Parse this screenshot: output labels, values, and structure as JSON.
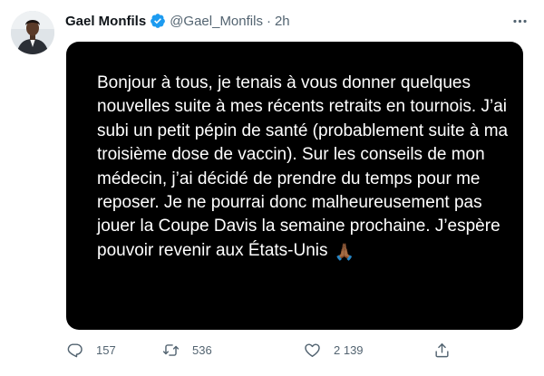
{
  "author": {
    "name": "Gael Monfils",
    "handle": "@Gael_Monfils",
    "separator": "·",
    "time": "2h",
    "verified_color": "#1d9bf0"
  },
  "media": {
    "text": "Bonjour à tous, je tenais à vous donner quelques nouvelles suite à mes récents retraits en tournois. J’ai subi un petit pépin de santé (probablement suite à ma troisième dose de vaccin). Sur les conseils de mon médecin, j’ai décidé de prendre du temps pour me reposer. Je ne pourrai donc malheureusement pas jouer la Coupe Davis la semaine prochaine. J’espère pouvoir revenir aux États-Unis",
    "emoji": "🙏🏾"
  },
  "actions": {
    "replies": "157",
    "retweets": "536",
    "likes": "2 139"
  },
  "icons": {
    "avatar": "avatar-photo",
    "verified": "verified-badge-icon",
    "more": "more-icon",
    "reply": "reply-icon",
    "retweet": "retweet-icon",
    "like": "heart-icon",
    "share": "share-icon"
  },
  "colors": {
    "text_primary": "#0f1419",
    "text_secondary": "#536471",
    "media_background": "#000000",
    "media_text": "#ffffff"
  }
}
